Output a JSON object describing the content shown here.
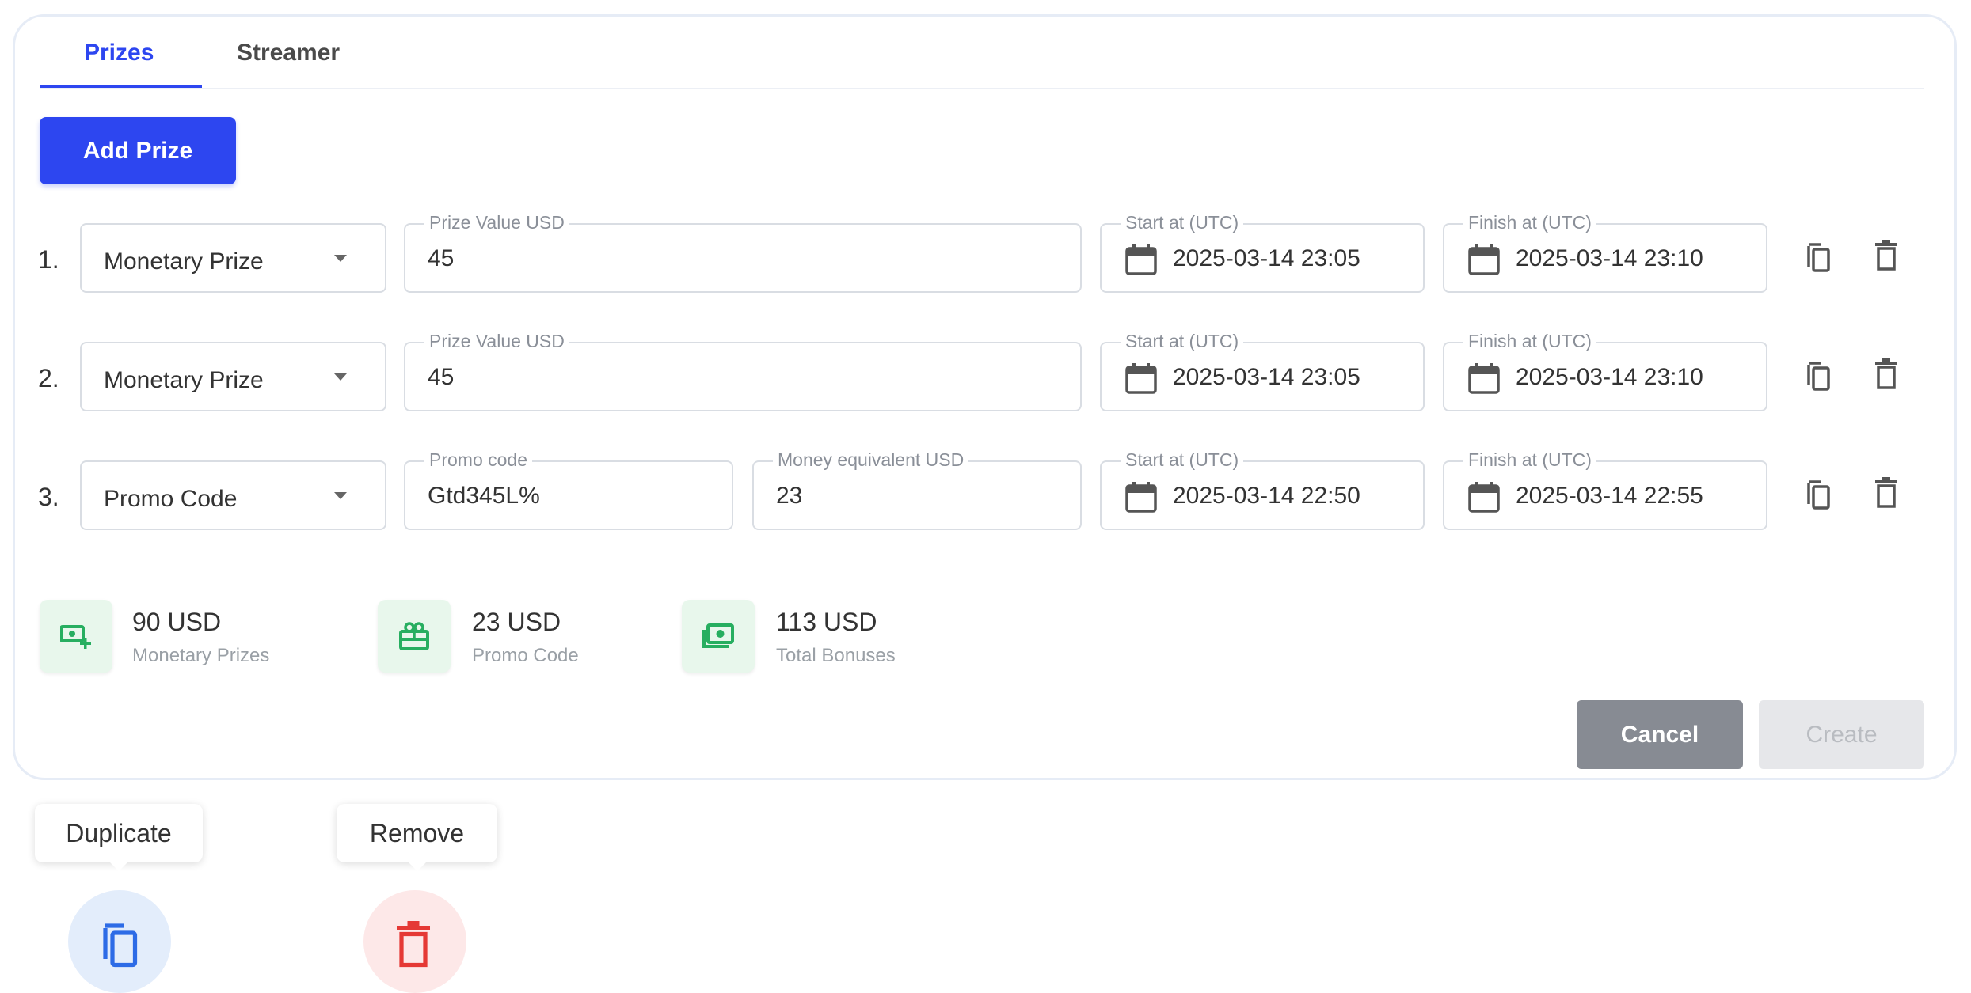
{
  "tabs": [
    {
      "label": "Prizes",
      "active": true
    },
    {
      "label": "Streamer",
      "active": false
    }
  ],
  "add_prize_label": "Add Prize",
  "prize_rows": [
    {
      "number": "1.",
      "type": "Monetary Prize",
      "fields": [
        {
          "label": "Prize Value USD",
          "value": "45"
        }
      ],
      "start": {
        "label": "Start at (UTC)",
        "value": "2025-03-14 23:05"
      },
      "finish": {
        "label": "Finish at (UTC)",
        "value": "2025-03-14 23:10"
      }
    },
    {
      "number": "2.",
      "type": "Monetary Prize",
      "fields": [
        {
          "label": "Prize Value USD",
          "value": "45"
        }
      ],
      "start": {
        "label": "Start at (UTC)",
        "value": "2025-03-14 23:05"
      },
      "finish": {
        "label": "Finish at (UTC)",
        "value": "2025-03-14 23:10"
      }
    },
    {
      "number": "3.",
      "type": "Promo Code",
      "fields": [
        {
          "label": "Promo code",
          "value": "Gtd345L%"
        },
        {
          "label": "Money equivalent USD",
          "value": "23"
        }
      ],
      "start": {
        "label": "Start at (UTC)",
        "value": "2025-03-14 22:50"
      },
      "finish": {
        "label": "Finish at (UTC)",
        "value": "2025-03-14 22:55"
      }
    }
  ],
  "summary": [
    {
      "value": "90 USD",
      "label": "Monetary Prizes",
      "icon": "cash-plus-icon"
    },
    {
      "value": "23 USD",
      "label": "Promo Code",
      "icon": "gift-icon"
    },
    {
      "value": "113 USD",
      "label": "Total Bonuses",
      "icon": "money-bill-icon"
    }
  ],
  "cancel_label": "Cancel",
  "create_label": "Create",
  "tooltips": {
    "duplicate": "Duplicate",
    "remove": "Remove"
  },
  "colors": {
    "accent": "#2d46f0",
    "success": "#27ae60",
    "danger": "#e53935",
    "duplicate_hover_bg": "#e3edfb",
    "remove_hover_bg": "#fde8e8"
  }
}
